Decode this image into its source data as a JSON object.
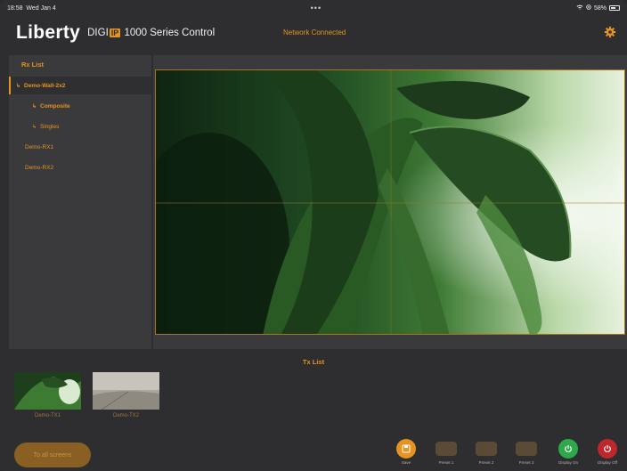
{
  "status_bar": {
    "time": "18:58",
    "date": "Wed Jan 4",
    "dots": "•••",
    "battery": "58%",
    "battery_level": 0.58
  },
  "header": {
    "logo": "Liberty",
    "product_prefix": "DIGI",
    "product_badge": "IP",
    "product_suffix": " 1000 Series Control",
    "network_status": "Network Connected"
  },
  "rx_list": {
    "title": "Rx List",
    "items": [
      {
        "label": "Demo-Wall-2x2",
        "arrow": "↳"
      },
      {
        "label": "Composite",
        "arrow": "↳"
      },
      {
        "label": "Singles",
        "arrow": "↳"
      },
      {
        "label": "Demo-RX1"
      },
      {
        "label": "Demo-RX2"
      }
    ]
  },
  "tx_list": {
    "title": "Tx List",
    "items": [
      {
        "label": "Demo-TX1"
      },
      {
        "label": "Demo-TX2"
      }
    ]
  },
  "controls": {
    "to_all_screens": "To all screens",
    "save": "Save",
    "preset1": "Preset 1",
    "preset2": "Preset 2",
    "preset3": "Preset 3",
    "display_on": "Display On",
    "display_off": "Display Off"
  },
  "colors": {
    "accent": "#e5941f",
    "panel": "#3a3a3c",
    "background": "#2e2e30",
    "on": "#2ea84a",
    "off": "#c0272d"
  }
}
